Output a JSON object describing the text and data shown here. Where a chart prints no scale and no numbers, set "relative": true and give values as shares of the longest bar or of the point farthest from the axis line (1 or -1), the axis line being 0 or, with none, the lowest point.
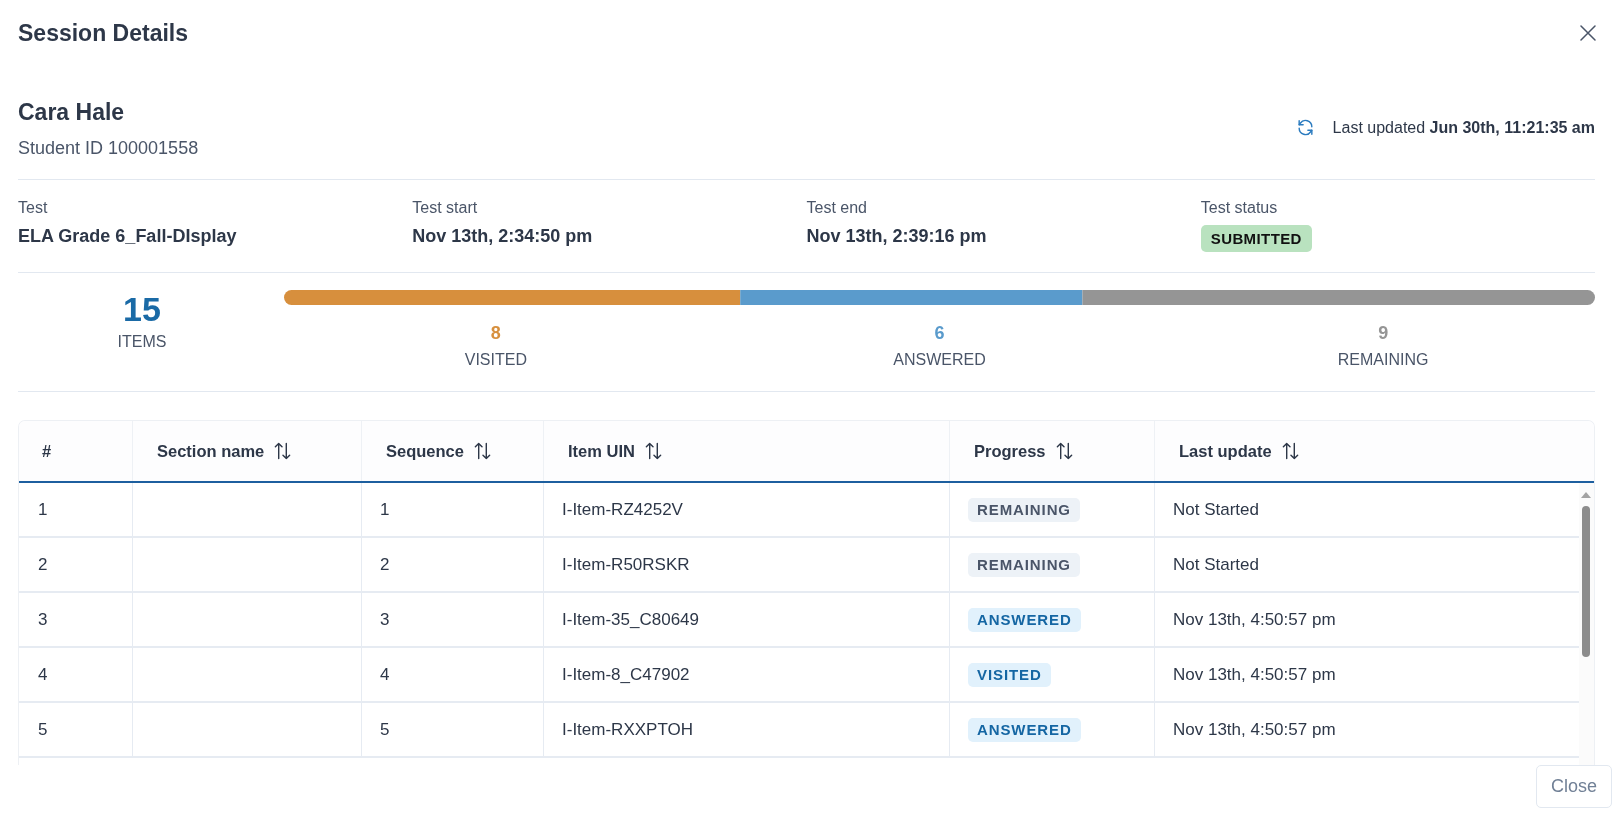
{
  "dialog": {
    "title": "Session Details"
  },
  "student": {
    "name": "Cara Hale",
    "student_id": "Student ID 100001558",
    "last_updated": "Last updated **Jun 30th, 11:21:35 am**"
  },
  "test_info": [
    {
      "kind": "text",
      "label": "Test",
      "value": "ELA Grade 6_Fall-DIsplay"
    },
    {
      "kind": "text",
      "label": "Test start",
      "value": "Nov 13th, 2:34:50 pm"
    },
    {
      "kind": "text",
      "label": "Test end",
      "value": "Nov 13th, 2:39:16 pm"
    },
    {
      "kind": "badge",
      "label": "Test status",
      "value": "SUBMITTED"
    }
  ],
  "summary": {
    "total": "15",
    "total_label": "ITEMS",
    "chart_data": {
      "type": "bar",
      "orientation": "horizontal",
      "stacked": true,
      "relative": true,
      "series": [
        {
          "name": "VISITED",
          "color": "#d78f3d",
          "values": [
            0.348
          ]
        },
        {
          "name": "ANSWERED",
          "color": "#5a9bcc",
          "values": [
            0.261
          ]
        },
        {
          "name": "REMAINING",
          "color": "#959595",
          "values": [
            0.391
          ]
        }
      ]
    },
    "counts": [
      "8",
      "6",
      "9"
    ]
  },
  "table": {
    "columns": [
      {
        "label": "#",
        "sortable": false
      },
      {
        "label": "Section name",
        "sortable": true
      },
      {
        "label": "Sequence",
        "sortable": true
      },
      {
        "label": "Item UIN",
        "sortable": true
      },
      {
        "label": "Progress",
        "sortable": true
      },
      {
        "label": "Last update",
        "sortable": true
      }
    ],
    "rows": [
      {
        "number": "1",
        "sequence": "1",
        "item_uin": "I-Item-RZ4252V",
        "progress": {
          "label": "REMAINING",
          "kind": "remaining"
        },
        "last_update": "Not Started"
      },
      {
        "number": "2",
        "sequence": "2",
        "item_uin": "I-Item-R50RSKR",
        "progress": {
          "label": "REMAINING",
          "kind": "remaining"
        },
        "last_update": "Not Started"
      },
      {
        "number": "3",
        "sequence": "3",
        "item_uin": "I-Item-35_C80649",
        "progress": {
          "label": "ANSWERED",
          "kind": "answered"
        },
        "last_update": "Nov 13th, 4:50:57 pm"
      },
      {
        "number": "4",
        "sequence": "4",
        "item_uin": "I-Item-8_C47902",
        "progress": {
          "label": "VISITED",
          "kind": "visited"
        },
        "last_update": "Nov 13th, 4:50:57 pm"
      },
      {
        "number": "5",
        "sequence": "5",
        "item_uin": "I-Item-RXXPTOH",
        "progress": {
          "label": "ANSWERED",
          "kind": "answered"
        },
        "last_update": "Nov 13th, 4:50:57 pm"
      }
    ]
  },
  "footer": {
    "buttons": [
      "Close"
    ]
  }
}
